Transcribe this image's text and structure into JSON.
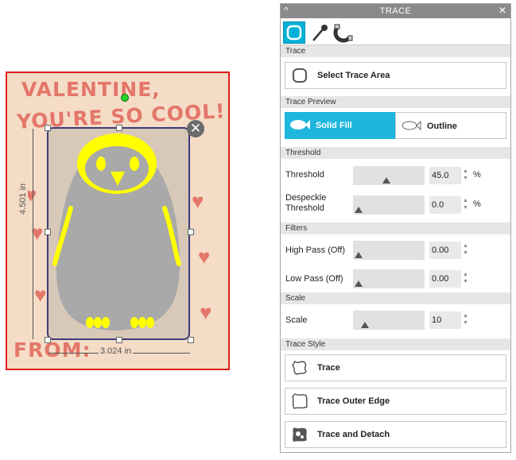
{
  "design": {
    "line1": "VALENTINE,",
    "line2": "YOU'RE SO COOL!",
    "line3": "FROM:",
    "width_label": "3.024 in",
    "height_label": "4.501 in"
  },
  "panel": {
    "title": "TRACE",
    "sections": {
      "trace": "Trace",
      "trace_preview": "Trace Preview",
      "threshold": "Threshold",
      "filters": "Filters",
      "scale": "Scale",
      "trace_style": "Trace Style"
    },
    "select_trace_area": "Select Trace Area",
    "preview": {
      "solid_fill": "Solid Fill",
      "outline": "Outline"
    },
    "threshold": {
      "label": "Threshold",
      "value": "45.0",
      "unit": "%",
      "level": 0.45
    },
    "despeckle": {
      "label_line1": "Despeckle",
      "label_line2": "Threshold",
      "value": "0.0",
      "unit": "%",
      "level": 0.0
    },
    "high_pass": {
      "label": "High Pass (Off)",
      "value": "0.00",
      "level": 0.0
    },
    "low_pass": {
      "label": "Low Pass (Off)",
      "value": "0.00",
      "level": 0.0
    },
    "scale": {
      "label": "Scale",
      "value": "10",
      "level": 0.1
    },
    "style_buttons": {
      "trace": "Trace",
      "trace_outer_edge": "Trace Outer Edge",
      "trace_and_detach": "Trace and Detach"
    }
  },
  "colors": {
    "accent": "#1fb6dd",
    "selection_border": "#e01c1c",
    "trace_fill": "#ffff00",
    "penguin_gray": "#a9a9a9"
  },
  "icons": {
    "tool_trace": "trace-area-icon",
    "tool_picker": "eyedropper-icon",
    "tool_magnet": "magnet-icon",
    "solid_fill": "fish-filled-icon",
    "outline": "fish-outline-icon"
  }
}
